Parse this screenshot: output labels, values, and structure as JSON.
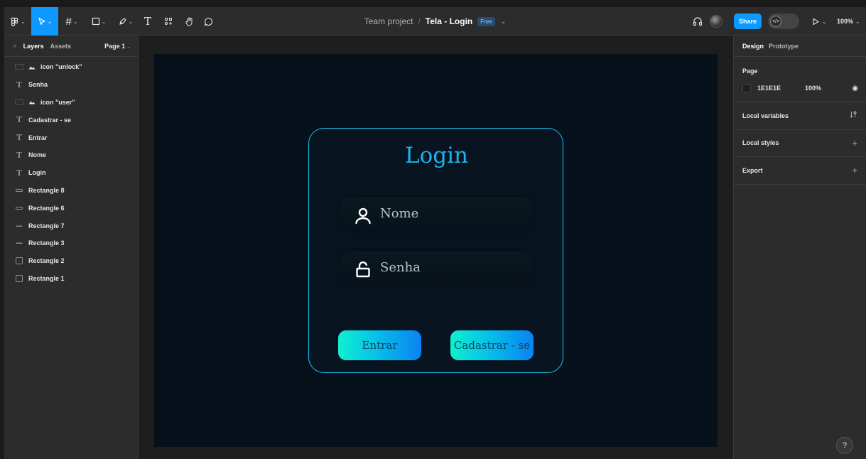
{
  "toolbar": {
    "project": "Team project",
    "separator": "/",
    "file_name": "Tela - Login",
    "plan_badge": "Free",
    "share_label": "Share",
    "zoom": "100%"
  },
  "left_panel": {
    "tab_layers": "Layers",
    "tab_assets": "Assets",
    "page_selector": "Page 1",
    "layers": [
      {
        "name": "icon \"unlock\"",
        "kind": "component"
      },
      {
        "name": "Senha",
        "kind": "text"
      },
      {
        "name": "icon \"user\"",
        "kind": "component"
      },
      {
        "name": "Cadastrar - se",
        "kind": "text"
      },
      {
        "name": "Entrar",
        "kind": "text"
      },
      {
        "name": "Nome",
        "kind": "text"
      },
      {
        "name": "Login",
        "kind": "text"
      },
      {
        "name": "Rectangle 8",
        "kind": "rectangle-thin"
      },
      {
        "name": "Rectangle 6",
        "kind": "rectangle-thin"
      },
      {
        "name": "Rectangle 7",
        "kind": "rectangle-line"
      },
      {
        "name": "Rectangle 3",
        "kind": "rectangle-line"
      },
      {
        "name": "Rectangle 2",
        "kind": "rectangle"
      },
      {
        "name": "Rectangle 1",
        "kind": "rectangle"
      }
    ]
  },
  "canvas": {
    "login_card": {
      "title": "Login",
      "name_field": {
        "placeholder": "Nome",
        "icon": "user-icon"
      },
      "password_field": {
        "placeholder": "Senha",
        "icon": "unlock-icon"
      },
      "enter_button": "Entrar",
      "register_button": "Cadastrar - se"
    },
    "colors": {
      "frame_bg": "#06111b",
      "card_border": "#19c3f0",
      "title": "#1bb4f0",
      "button_gradient_start": "#0ff0d0",
      "button_gradient_end": "#0a82f2"
    }
  },
  "right_panel": {
    "tab_design": "Design",
    "tab_prototype": "Prototype",
    "page_heading": "Page",
    "page_color": "1E1E1E",
    "page_opacity": "100%",
    "local_variables": "Local variables",
    "local_styles": "Local styles",
    "export": "Export",
    "help": "?"
  }
}
